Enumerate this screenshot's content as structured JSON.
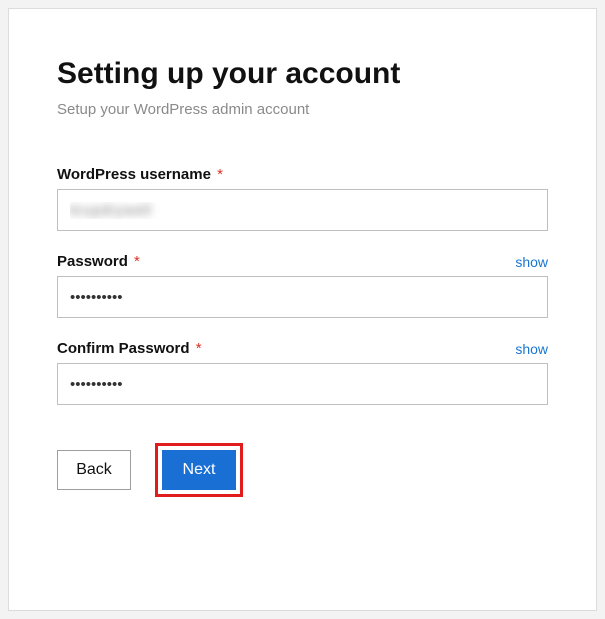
{
  "header": {
    "title": "Setting up your account",
    "subtitle": "Setup your WordPress admin account"
  },
  "fields": {
    "username": {
      "label": "WordPress username",
      "required_mark": "*",
      "value": "krupdrywell"
    },
    "password": {
      "label": "Password",
      "required_mark": "*",
      "show_link": "show",
      "value": "••••••••••"
    },
    "confirm": {
      "label": "Confirm Password",
      "required_mark": "*",
      "show_link": "show",
      "value": "••••••••••"
    }
  },
  "buttons": {
    "back": "Back",
    "next": "Next"
  }
}
